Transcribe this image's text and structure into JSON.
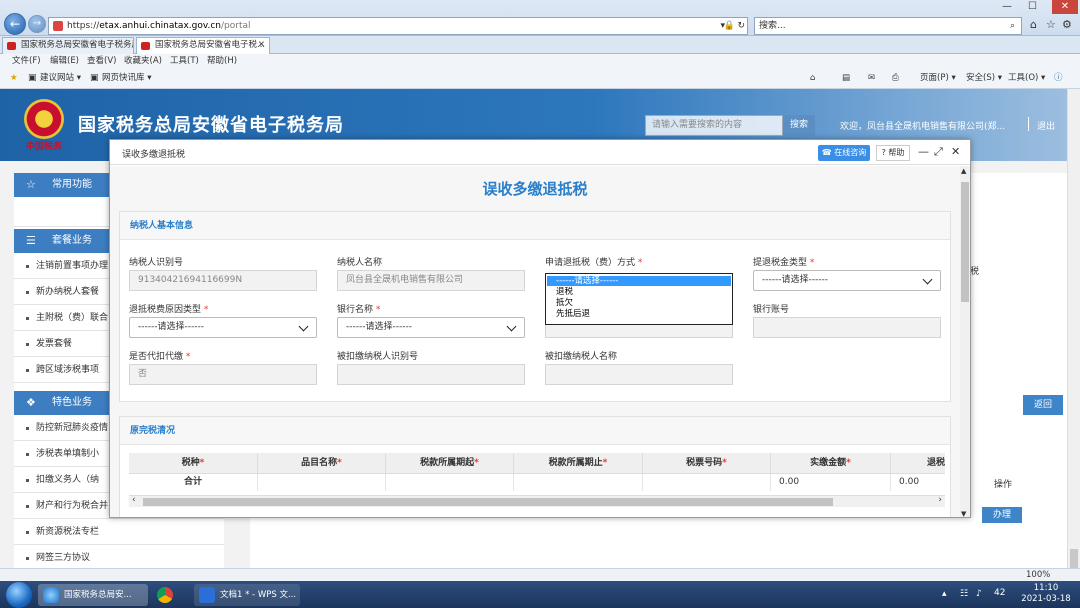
{
  "browser": {
    "address_prefix": "https://",
    "address_domain": "etax.anhui.chinatax.gov.cn",
    "address_path": "/portal",
    "search_placeholder": "搜索...",
    "tabs": [
      {
        "label": "国家税务总局安徽省电子税务局"
      },
      {
        "label": "国家税务总局安徽省电子税..."
      }
    ],
    "menu": [
      "文件(F)",
      "编辑(E)",
      "查看(V)",
      "收藏夹(A)",
      "工具(T)",
      "帮助(H)"
    ],
    "favorites": [
      "建议网站 ▾",
      "网页快讯库 ▾"
    ],
    "commandbar": [
      "页面(P) ▾",
      "安全(S) ▾",
      "工具(O) ▾"
    ],
    "zoom": "100%"
  },
  "site": {
    "emblem_text": "中国税务",
    "title": "国家税务总局安徽省电子税务局",
    "search_placeholder": "请输入需要搜索的内容",
    "search_button": "搜索",
    "welcome": "欢迎，凤台县全晟机电销售有限公司(郑...",
    "logout": "退出"
  },
  "sidebar": {
    "sections": [
      {
        "label": "常用功能"
      },
      {
        "label": "套餐业务"
      },
      {
        "label": "特色业务"
      }
    ],
    "items_a": [
      "注销前置事项办理",
      "新办纳税人套餐",
      "主附税（费）联合",
      "发票套餐",
      "跨区域涉税事项"
    ],
    "items_b": [
      "防控新冠肺炎疫情",
      "涉税表单填制小",
      "扣缴义务人（纳",
      "财产和行为税合并",
      "新资源税法专栏",
      "网签三方协议"
    ]
  },
  "background": {
    "side_char": "税",
    "back_button": "返回",
    "op_header": "操作",
    "handle_button": "办理"
  },
  "modal": {
    "title": "误收多缴退抵税",
    "consult_button": "在线咨询",
    "help_button": "帮助",
    "form_title": "误收多缴退抵税",
    "section1": "纳税人基本信息",
    "section2": "原完税清况",
    "fields": {
      "taxpayer_id_label": "纳税人识别号",
      "taxpayer_id_value": "91340421694116699N",
      "taxpayer_name_label": "纳税人名称",
      "taxpayer_name_value": "凤台县全晟机电销售有限公司",
      "refund_method_label": "申请退抵税（费）方式",
      "refund_type_label": "提退税金类型",
      "refund_type_value": "------请选择------",
      "reason_label": "退抵税费原因类型",
      "reason_value": "------请选择------",
      "bank_label": "银行名称",
      "bank_value": "------请选择------",
      "account_label": "银行账号",
      "withhold_label": "是否代扣代缴",
      "withhold_value": "否",
      "withheld_id_label": "被扣缴纳税人识别号",
      "withheld_name_label": "被扣缴纳税人名称"
    },
    "dropdown_options": [
      "------请选择------",
      "退税",
      "抵欠",
      "先抵后退"
    ],
    "table": {
      "headers": [
        "税种",
        "品目名称",
        "税款所属期起",
        "税款所属期止",
        "税票号码",
        "实缴金额",
        "退税"
      ],
      "total_label": "合计",
      "total_paid": "0.00",
      "total_refund": "0.00"
    }
  },
  "taskbar": {
    "items": [
      "国家税务总局安...",
      "文档1 * - WPS 文..."
    ],
    "time": "11:10",
    "date": "2021-03-18",
    "badge": "42"
  }
}
